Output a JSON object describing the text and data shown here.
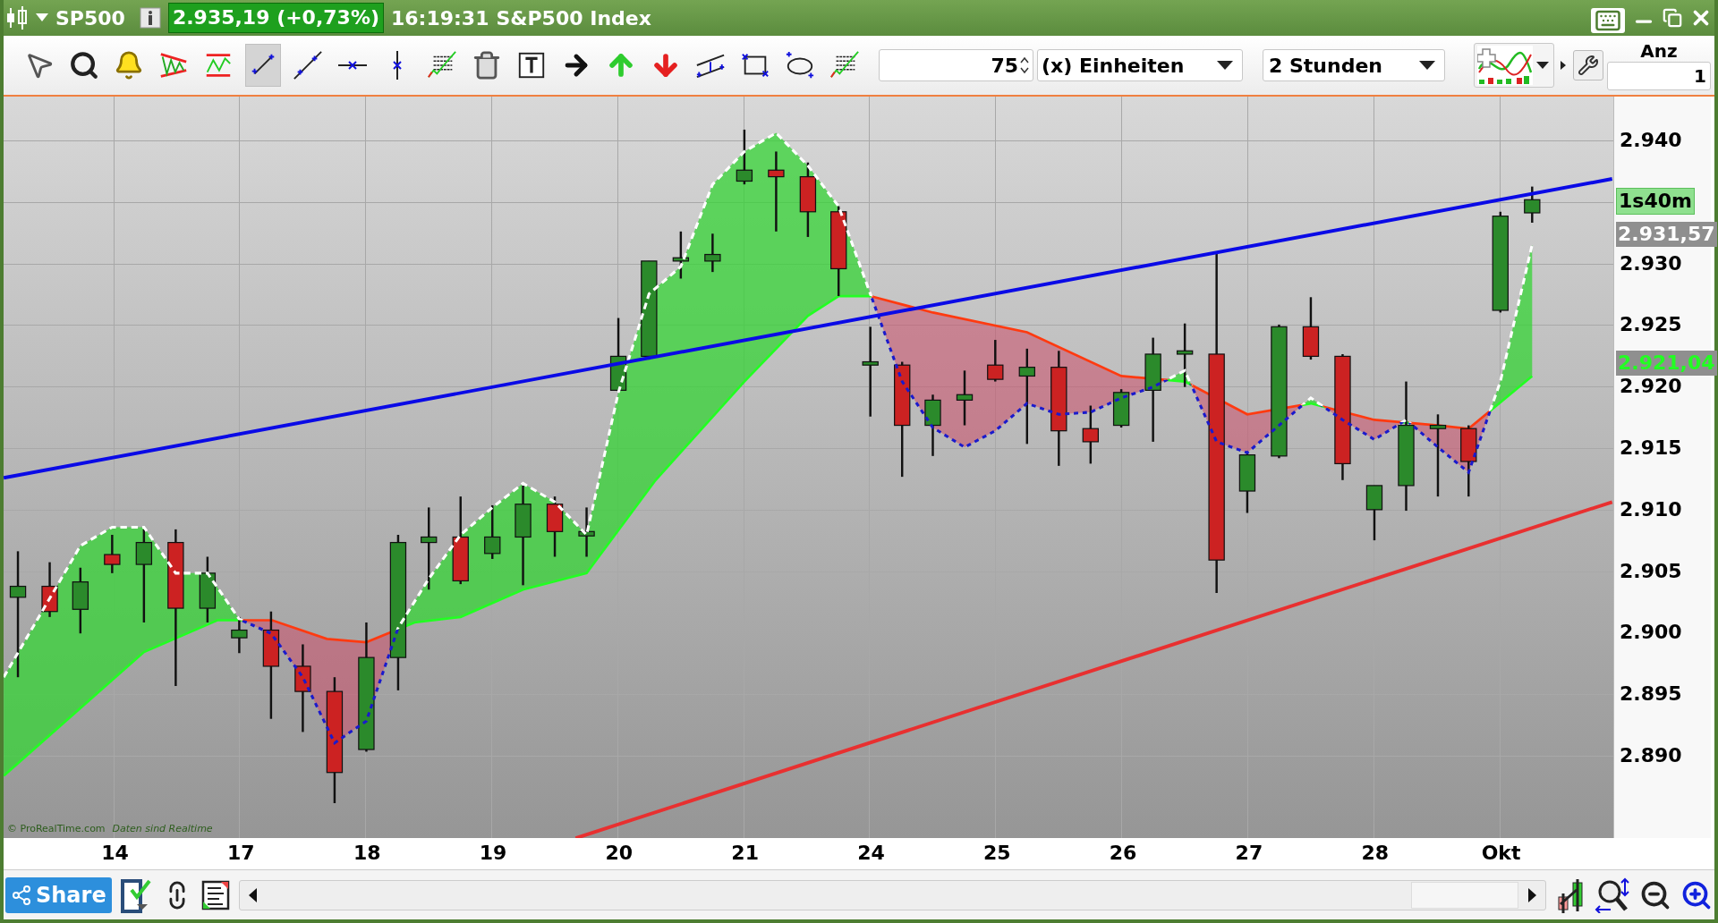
{
  "window": {
    "symbol": "SP500",
    "price": "2.935,19 (+0,73%)",
    "time": "16:19:31",
    "instrument": "S&P500 Index"
  },
  "toolbar": {
    "tools": [
      {
        "kind": "cursor",
        "selected": false
      },
      {
        "kind": "zoom",
        "selected": false
      },
      {
        "kind": "alert",
        "selected": false
      },
      {
        "kind": "triangle",
        "selected": false
      },
      {
        "kind": "channel",
        "selected": false
      },
      {
        "kind": "segment",
        "selected": true
      },
      {
        "kind": "line",
        "selected": false
      },
      {
        "kind": "hline",
        "selected": false
      },
      {
        "kind": "vline",
        "selected": false
      },
      {
        "kind": "levels",
        "selected": false
      },
      {
        "kind": "trash",
        "selected": false
      },
      {
        "kind": "text",
        "selected": false
      },
      {
        "kind": "arrow",
        "selected": false
      },
      {
        "kind": "up",
        "selected": false
      },
      {
        "kind": "down",
        "selected": false
      },
      {
        "kind": "parallel",
        "selected": false
      },
      {
        "kind": "rectangle",
        "selected": false
      },
      {
        "kind": "ellipse",
        "selected": false
      },
      {
        "kind": "levels",
        "selected": false
      }
    ],
    "quantity": "75",
    "units": "(x) Einheiten",
    "interval": "2 Stunden",
    "count_label": "Anz",
    "count": "1"
  },
  "chart": {
    "price_axis": [
      "2.940",
      "2.930",
      "2.925",
      "2.920",
      "2.915",
      "2.910",
      "2.905",
      "2.900",
      "2.895",
      "2.890"
    ],
    "date_axis": [
      "14",
      "17",
      "18",
      "19",
      "20",
      "21",
      "24",
      "25",
      "26",
      "27",
      "28",
      "Okt"
    ],
    "price_tags": [
      {
        "kind": "timer",
        "text": "1s40m"
      },
      {
        "kind": "last",
        "text": "2.931,57"
      },
      {
        "kind": "indicator",
        "text": "2.921,04"
      }
    ],
    "credit": "© ProRealTime.com",
    "note": "Daten sind Realtime"
  },
  "bottom_bar": {
    "share": "Share"
  }
}
